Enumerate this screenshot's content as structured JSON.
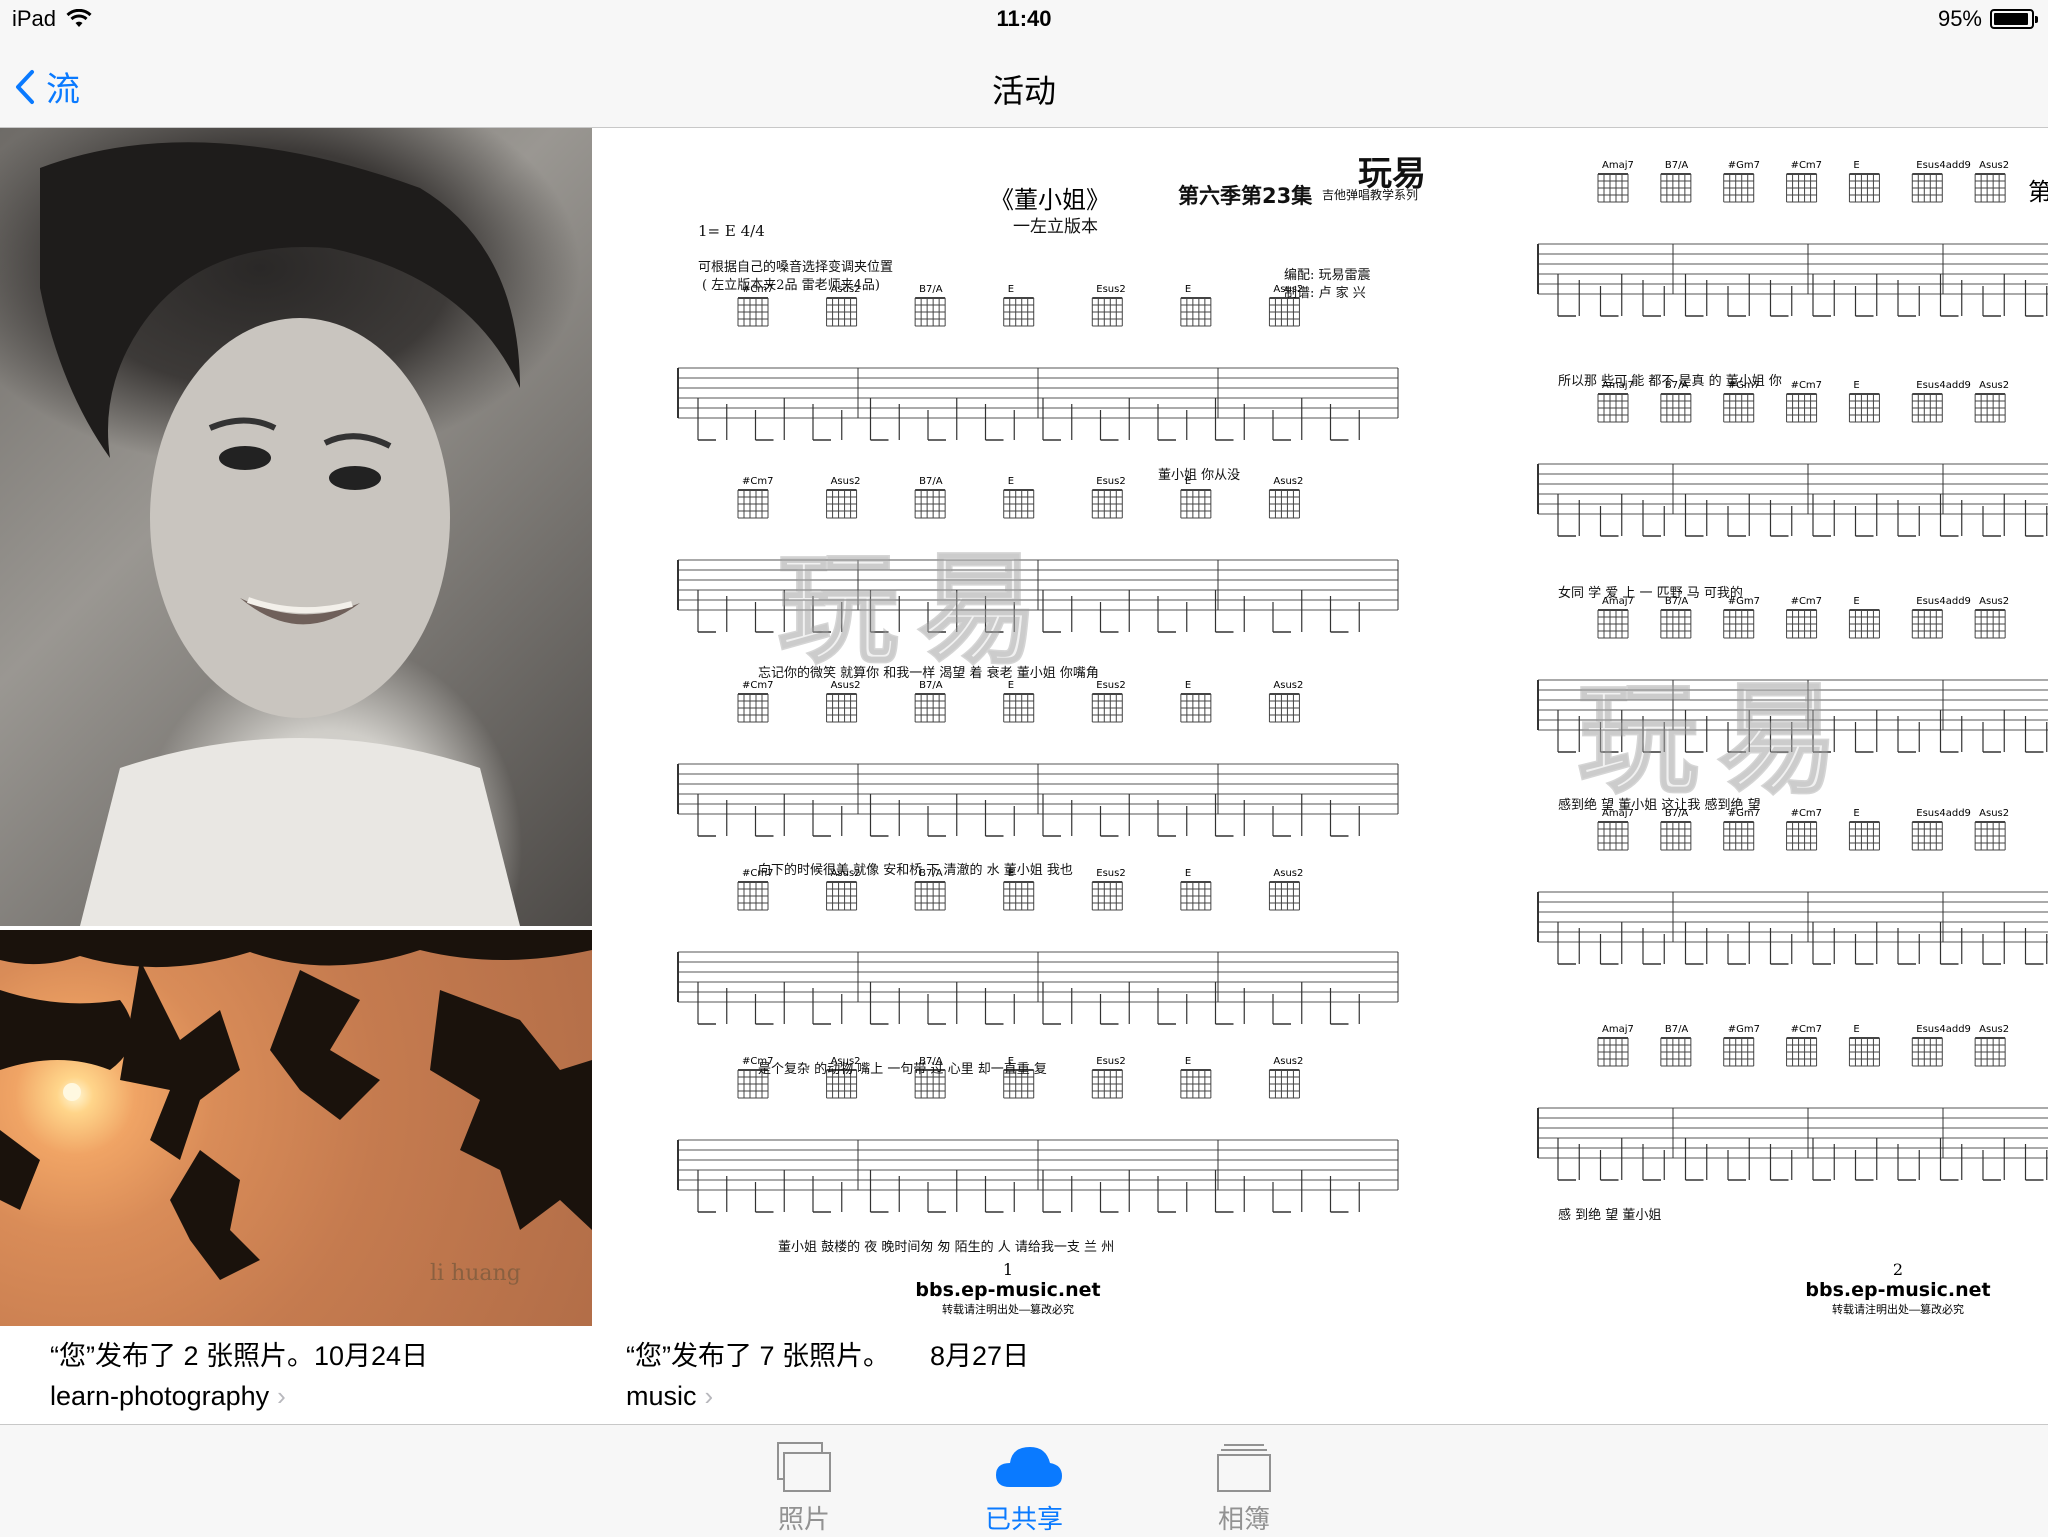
{
  "status_bar": {
    "device": "iPad",
    "time": "11:40",
    "battery": "95%",
    "battery_level": 0.95
  },
  "nav": {
    "back_label": "流",
    "title": "活动"
  },
  "posts": [
    {
      "text": "“您”发布了 2 张照片。10月24日",
      "album": "learn-photography"
    },
    {
      "text": "“您”发布了 7 张照片。",
      "date": "8月27日",
      "album": "music"
    }
  ],
  "photo_signature": "li huang",
  "sheet1": {
    "title": "《董小姐》",
    "subtitle": "一左立版本",
    "series": "第六季第23集",
    "series_sub": "吉他弹唱教学系列",
    "brand": "玩易",
    "key": "1= E 4/4",
    "note1": "可根据自己的嗓音选择变调夹位置",
    "note2": "( 左立版本夹2品  雷老师夹4品)",
    "arranger": "编配: 玩易雷震",
    "transcriber": "制谱: 卢 家 兴",
    "lyrics": [
      "董小姐    你从没",
      "忘记你的微笑  就算你  和我一样   渴望  着  衰老    董小姐   你嘴角",
      "向下的时候很美   就像  安和桥 下   清澈的 水      董小姐   我也",
      "是个复杂 的动物   嘴上 一句带 过   心里 却一直重   复",
      "董小姐  鼓楼的 夜 晚时间匆 匆  陌生的 人  请给我一支  兰  州"
    ],
    "chords": [
      "#Cm7",
      "Asus2",
      "B7/A",
      "E",
      "Esus2",
      "E",
      "Asus2"
    ],
    "page": "1",
    "site": "bbs.ep-music.net",
    "footnote": "转载请注明出处—篡改必究"
  },
  "sheet2": {
    "title_fragment": "第",
    "lyrics": [
      "所以那 些可  能  都不 是真   的  董小姐     你",
      "女同  学          爱 上 一 匹野 马     可我的",
      "感到绝 望   董小姐           这让我  感到绝 望",
      "感 到绝  望     董小姐"
    ],
    "chords": [
      "Amaj7",
      "B7/A",
      "#Gm7",
      "#Cm7",
      "E",
      "Esus4add9",
      "Asus2"
    ],
    "page": "2",
    "site": "bbs.ep-music.net",
    "footnote": "转载请注明出处—篡改必究"
  },
  "tabs": [
    {
      "label": "照片",
      "icon": "photos-icon",
      "active": false
    },
    {
      "label": "已共享",
      "icon": "cloud-icon",
      "active": true
    },
    {
      "label": "相簿",
      "icon": "albums-icon",
      "active": false
    }
  ],
  "colors": {
    "accent": "#0a7aff",
    "inactive": "#929292"
  }
}
